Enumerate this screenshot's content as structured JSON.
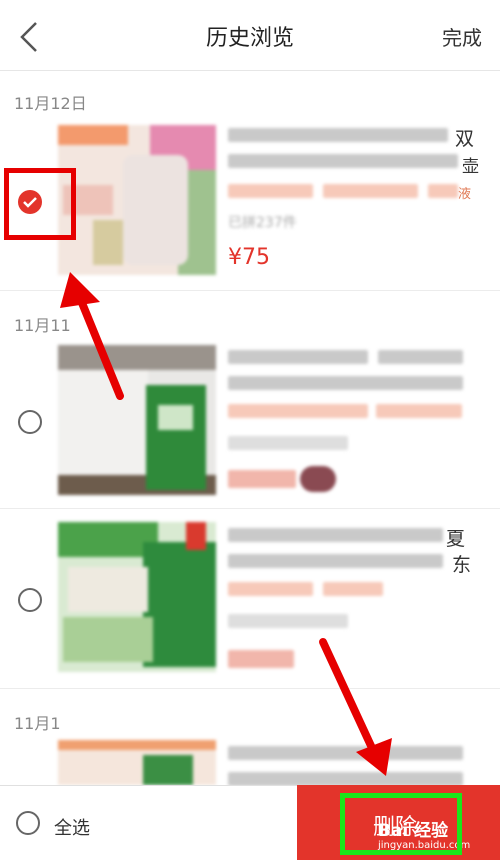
{
  "header": {
    "title": "历史浏览",
    "done_label": "完成",
    "back_icon": "chevron-left-icon"
  },
  "groups": [
    {
      "date": "11月12日"
    },
    {
      "date": "11月11"
    },
    {
      "date": "11月1"
    }
  ],
  "items": [
    {
      "checked": true,
      "visible_text": "双",
      "visible_text2": "壶",
      "visible_text3": "液",
      "sold_text": "已拼237件",
      "price": "¥75"
    },
    {
      "checked": false
    },
    {
      "checked": false,
      "visible_text": "夏",
      "visible_text2": "东"
    },
    {
      "checked": false
    }
  ],
  "bottom_bar": {
    "select_all_label": "全选",
    "delete_label": "删除"
  },
  "watermark": {
    "text": "Bai 经验",
    "url": "jingyan.baidu.com"
  },
  "colors": {
    "accent": "#e3342b",
    "annotation_red": "#e60000",
    "annotation_green": "#1ae61a"
  }
}
